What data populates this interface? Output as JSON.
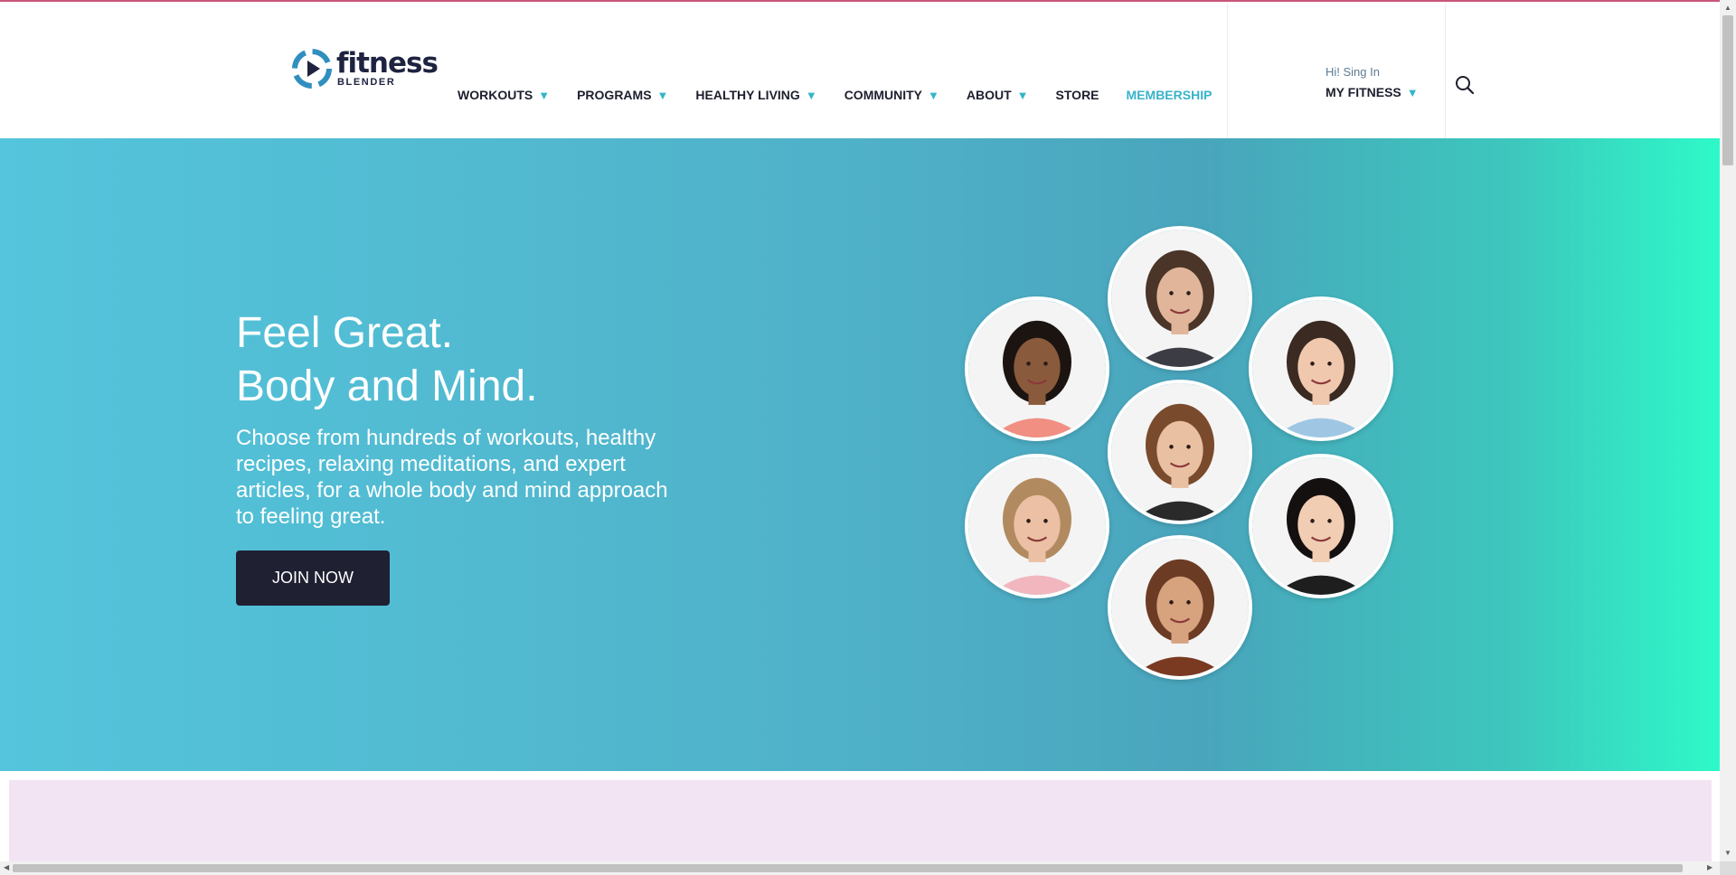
{
  "brand": {
    "name": "fitness",
    "sub": "BLENDER",
    "icon": "play-swirl-logo-icon",
    "primary_color": "#1d2340",
    "accent_color": "#32b6c9"
  },
  "nav": {
    "items": [
      {
        "label": "WORKOUTS",
        "dropdown": true
      },
      {
        "label": "PROGRAMS",
        "dropdown": true
      },
      {
        "label": "HEALTHY LIVING",
        "dropdown": true
      },
      {
        "label": "COMMUNITY",
        "dropdown": true
      },
      {
        "label": "ABOUT",
        "dropdown": true
      },
      {
        "label": "STORE",
        "dropdown": false
      },
      {
        "label": "MEMBERSHIP",
        "dropdown": false
      }
    ],
    "caret": "▼"
  },
  "account": {
    "greeting": "Hi! Sing In",
    "menu_label": "MY FITNESS",
    "search_icon": "search-icon"
  },
  "hero": {
    "title_line1": "Feel Great.",
    "title_line2": "Body and Mind.",
    "text": "Choose from hundreds of workouts, healthy recipes, relaxing meditations, and expert articles, for a whole body and mind approach to feeling great.",
    "cta": "JOIN NOW",
    "gradient": [
      "#54c5dc",
      "#49a5bc",
      "#2ef9c8"
    ],
    "trainers": [
      {
        "name": "trainer-photo-woman-curly-hair",
        "skin": "#8a5a3c",
        "hair": "#1c1410",
        "shirt": "#f08f82"
      },
      {
        "name": "trainer-photo-man-beard",
        "skin": "#e0b59a",
        "hair": "#4a3528",
        "shirt": "#3c3c44"
      },
      {
        "name": "trainer-photo-woman-ponytail",
        "skin": "#f0c8ae",
        "hair": "#3a2a22",
        "shirt": "#9fc7e4"
      },
      {
        "name": "trainer-photo-woman-long-hair",
        "skin": "#eac0a2",
        "hair": "#7a4a2c",
        "shirt": "#2a2a2a"
      },
      {
        "name": "trainer-photo-woman-blonde",
        "skin": "#ebc0a4",
        "hair": "#b18a60",
        "shirt": "#f1b6be"
      },
      {
        "name": "trainer-photo-woman-bob",
        "skin": "#f1cdb4",
        "hair": "#141010",
        "shirt": "#1e1e1e"
      },
      {
        "name": "trainer-photo-woman-dark-hair",
        "skin": "#d7a27e",
        "hair": "#6b3b24",
        "shirt": "#7a3a22"
      }
    ]
  }
}
